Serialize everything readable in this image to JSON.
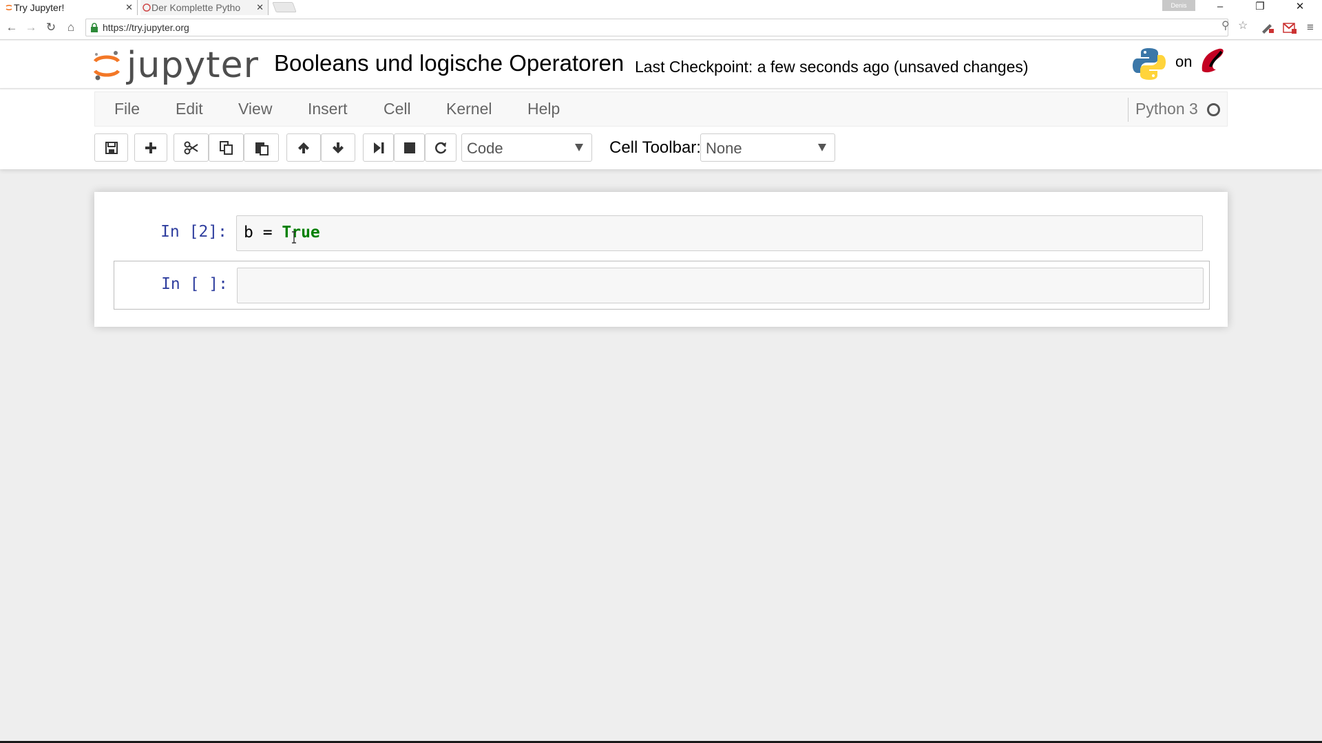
{
  "browser": {
    "tabs": [
      {
        "title": "Try Jupyter!",
        "active": true
      },
      {
        "title": "Der Komplette Pytho",
        "active": false
      }
    ],
    "profile_name": "Denis",
    "url": "https://try.jupyter.org"
  },
  "header": {
    "logo_text": "jupyter",
    "notebook_title": "Booleans und logische Operatoren",
    "checkpoint": "Last Checkpoint: a few seconds ago (unsaved changes)",
    "on_text": "on"
  },
  "menubar": {
    "items": [
      "File",
      "Edit",
      "View",
      "Insert",
      "Cell",
      "Kernel",
      "Help"
    ],
    "kernel_name": "Python 3"
  },
  "toolbar": {
    "cell_type": "Code",
    "cell_toolbar_label": "Cell Toolbar:",
    "cell_toolbar_value": "None"
  },
  "cells": [
    {
      "prompt": "In [2]:",
      "code_var": "b = ",
      "code_kw": "True"
    },
    {
      "prompt": "In [ ]:",
      "code": ""
    }
  ],
  "colors": {
    "prompt": "#303f9f",
    "keyword": "#008000",
    "jupyter_orange": "#f37726",
    "background": "#eeeeee"
  }
}
